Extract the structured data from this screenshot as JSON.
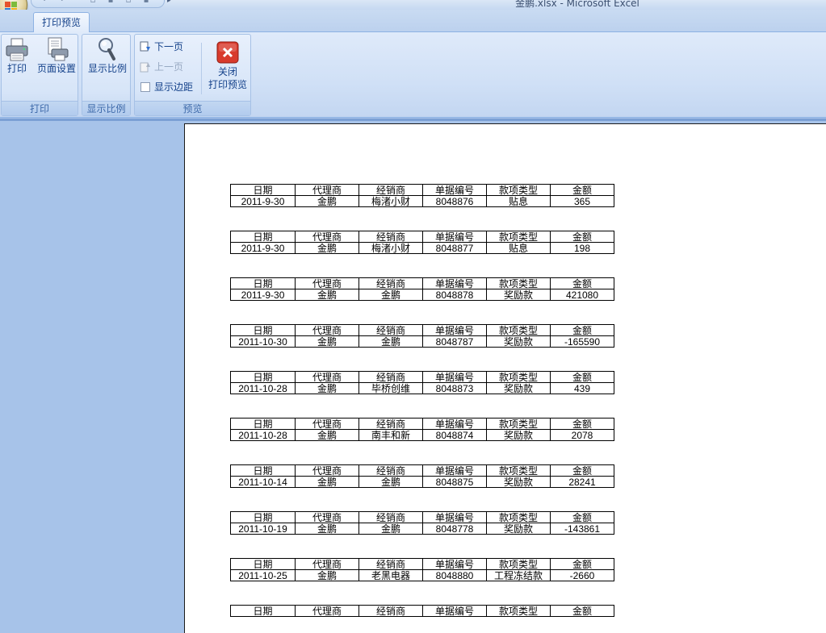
{
  "window": {
    "title": "金鹏.xlsx - Microsoft Excel"
  },
  "ribbon": {
    "tab": "打印预览",
    "groups": {
      "print": {
        "label": "打印",
        "print_btn": "打印",
        "page_setup_btn": "页面设置"
      },
      "zoom": {
        "label": "显示比例",
        "zoom_btn": "显示比例"
      },
      "preview": {
        "label": "预览",
        "next_page": "下一页",
        "prev_page": "上一页",
        "show_margins": "显示边距",
        "close_line1": "关闭",
        "close_line2": "打印预览"
      }
    }
  },
  "colors": {
    "ribbon_text": "#15428b",
    "workspace": "#a7c3e9",
    "close_red": "#d83a2c"
  },
  "report": {
    "headers": [
      "日期",
      "代理商",
      "经销商",
      "单据编号",
      "款项类型",
      "金额"
    ],
    "records": [
      [
        "2011-9-30",
        "金鹏",
        "梅渚小财",
        "8048876",
        "贴息",
        "365"
      ],
      [
        "2011-9-30",
        "金鹏",
        "梅渚小财",
        "8048877",
        "贴息",
        "198"
      ],
      [
        "2011-9-30",
        "金鹏",
        "金鹏",
        "8048878",
        "奖励款",
        "421080"
      ],
      [
        "2011-10-30",
        "金鹏",
        "金鹏",
        "8048787",
        "奖励款",
        "-165590"
      ],
      [
        "2011-10-28",
        "金鹏",
        "毕桥创维",
        "8048873",
        "奖励款",
        "439"
      ],
      [
        "2011-10-28",
        "金鹏",
        "南丰和新",
        "8048874",
        "奖励款",
        "2078"
      ],
      [
        "2011-10-14",
        "金鹏",
        "金鹏",
        "8048875",
        "奖励款",
        "28241"
      ],
      [
        "2011-10-19",
        "金鹏",
        "金鹏",
        "8048778",
        "奖励款",
        "-143861"
      ],
      [
        "2011-10-25",
        "金鹏",
        "老黑电器",
        "8048880",
        "工程冻结款",
        "-2660"
      ]
    ],
    "trailing_header_only": true
  }
}
